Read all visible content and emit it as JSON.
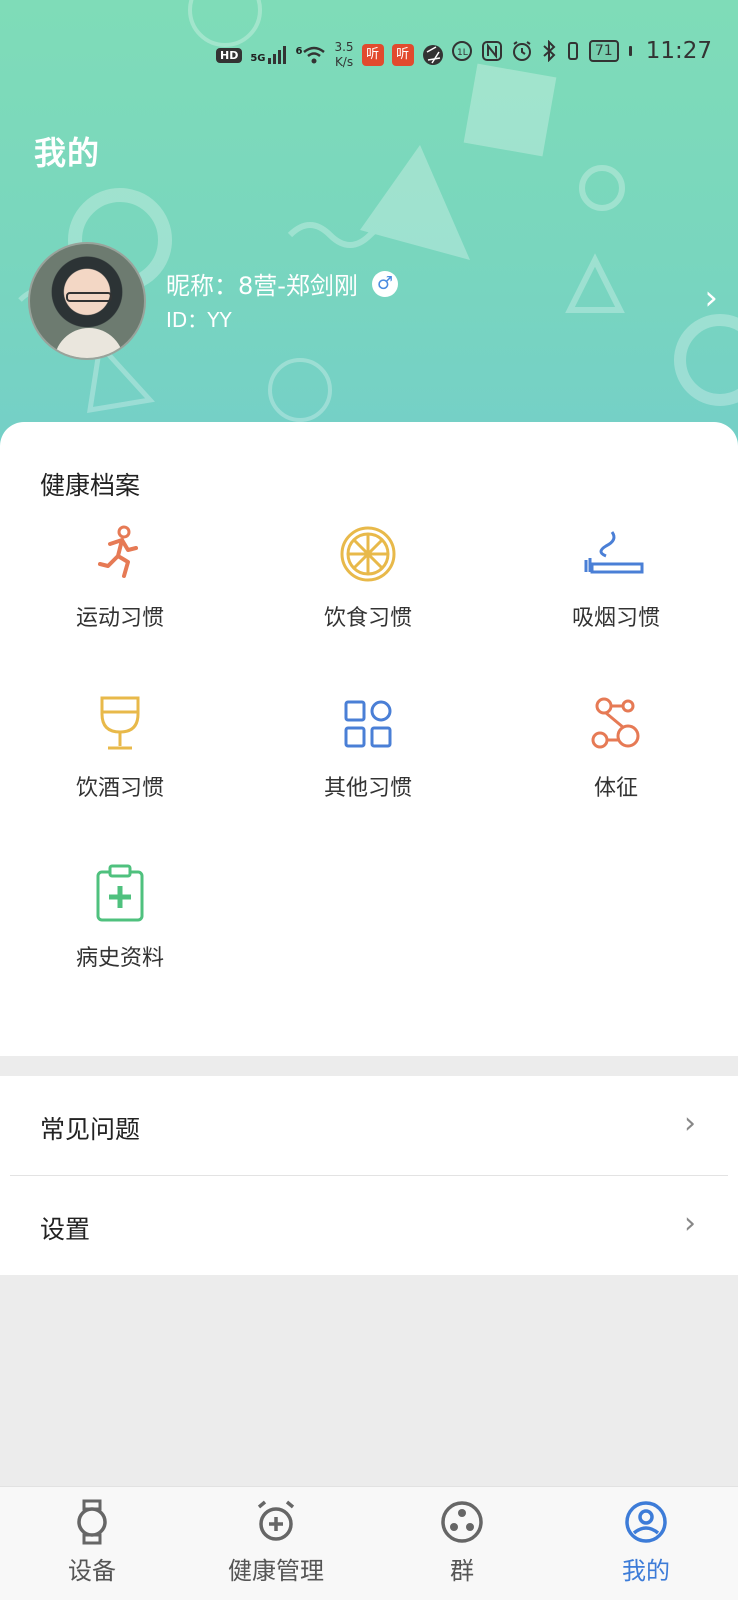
{
  "status_bar": {
    "hd": "HD",
    "net": "5G",
    "wifi": "6",
    "speed_value": "3.5",
    "speed_unit": "K/s",
    "app1": "听",
    "app2": "听",
    "battery": "71",
    "time": "11:27"
  },
  "header": {
    "title": "我的"
  },
  "profile": {
    "nickname": "昵称：8营-郑剑刚",
    "gender_symbol": "♂",
    "id": "ID：YY"
  },
  "health_records": {
    "title": "健康档案",
    "items": [
      {
        "label": "运动习惯",
        "icon": "running-person-icon",
        "color": "#e67a55"
      },
      {
        "label": "饮食习惯",
        "icon": "orange-slice-icon",
        "color": "#e8b94a"
      },
      {
        "label": "吸烟习惯",
        "icon": "cigarette-icon",
        "color": "#4a7fd6"
      },
      {
        "label": "饮酒习惯",
        "icon": "wine-glass-icon",
        "color": "#e8b94a"
      },
      {
        "label": "其他习惯",
        "icon": "grid-apps-icon",
        "color": "#4a7fd6"
      },
      {
        "label": "体征",
        "icon": "molecule-icon",
        "color": "#e67a55"
      },
      {
        "label": "病史资料",
        "icon": "clipboard-plus-icon",
        "color": "#4fc17e"
      }
    ]
  },
  "menu": {
    "faq": "常见问题",
    "settings": "设置"
  },
  "tabbar": {
    "tabs": [
      {
        "label": "设备",
        "icon": "watch-icon"
      },
      {
        "label": "健康管理",
        "icon": "alarm-plus-icon"
      },
      {
        "label": "群",
        "icon": "group-dots-icon"
      },
      {
        "label": "我的",
        "icon": "user-circle-icon",
        "active": true
      }
    ],
    "active_color": "#3d7cd8"
  }
}
